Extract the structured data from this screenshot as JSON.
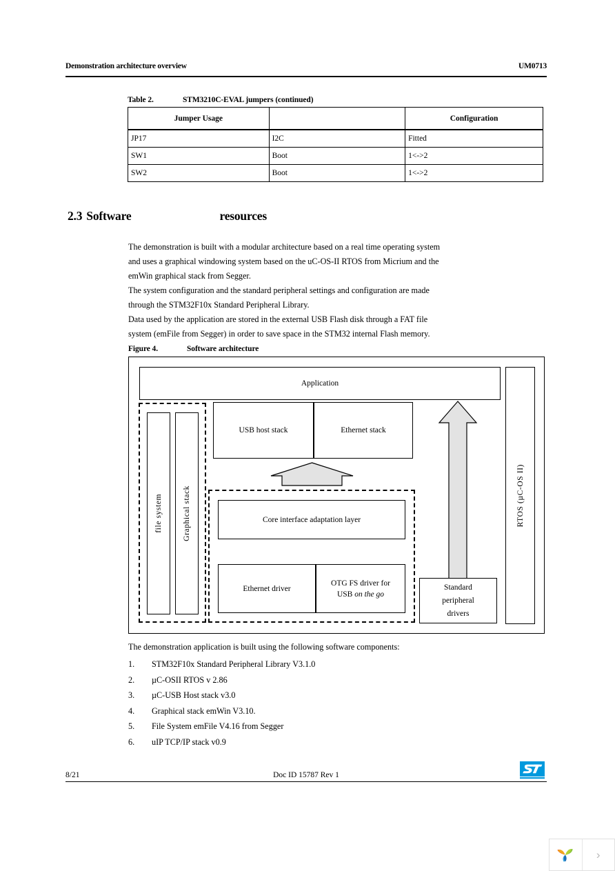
{
  "header": {
    "left": "Demonstration architecture overview",
    "right": "UM0713"
  },
  "table": {
    "caption_number": "Table 2.",
    "caption_title": "STM3210C-EVAL jumpers (continued)",
    "columns": [
      "Jumper Usage",
      "",
      "Configuration"
    ],
    "rows": [
      [
        "JP17",
        "I2C",
        "Fitted"
      ],
      [
        "SW1",
        "Boot",
        "1<->2"
      ],
      [
        "SW2",
        "Boot",
        "1<->2"
      ]
    ]
  },
  "section": {
    "number": "2.3",
    "title_part1": "Software",
    "title_part2": "resources",
    "paragraphs": [
      "The demonstration is built with a modular architecture based on a real time operating system and uses a graphical windowing system based on the uC-OS-II RTOS from Micrium and the emWin graphical stack from Segger.",
      "The system configuration and the standard peripheral settings and configuration are made through the STM32F10x Standard Peripheral Library.",
      "Data used by the application are stored in the external USB Flash disk through a FAT file system (emFile from Segger) in order to save space in the STM32 internal Flash memory."
    ]
  },
  "figure": {
    "caption_number": "Figure 4.",
    "caption_title": "Software architecture",
    "blocks": {
      "application": "Application",
      "usb_host_stack": "USB host stack",
      "ethernet_stack": "Ethernet stack",
      "file_system": "file system",
      "graphical_stack": "Graphical stack",
      "core_interface": "Core interface adaptation layer",
      "ethernet_driver": "Ethernet driver",
      "otg_line1": "OTG FS driver for",
      "otg_line2_prefix": "USB ",
      "otg_line2_italic": "on the go",
      "standard_peripheral_line1": "Standard",
      "standard_peripheral_line2": "peripheral",
      "standard_peripheral_line3": "drivers",
      "rtos": "RTOS (µC-OS II)"
    },
    "arrow_fill_color": "#e3e3e3"
  },
  "components": {
    "intro": "The demonstration application is built using the following software components:",
    "items": [
      {
        "number": "1.",
        "text": "STM32F10x Standard Peripheral Library V3.1.0"
      },
      {
        "number": "2.",
        "text": "µC-OSII RTOS v 2.86"
      },
      {
        "number": "3.",
        "text": "µC-USB Host stack v3.0"
      },
      {
        "number": "4.",
        "text": "Graphical stack emWin V3.10."
      },
      {
        "number": "5.",
        "text": "File System emFile V4.16 from Segger"
      },
      {
        "number": "6.",
        "text": "uIP TCP/IP stack v0.9"
      }
    ]
  },
  "footer": {
    "page_number": "8/21",
    "doc_id": "Doc ID 15787 Rev 1",
    "logo_color": "#0099dd"
  },
  "widget": {
    "next_glyph": "›"
  }
}
